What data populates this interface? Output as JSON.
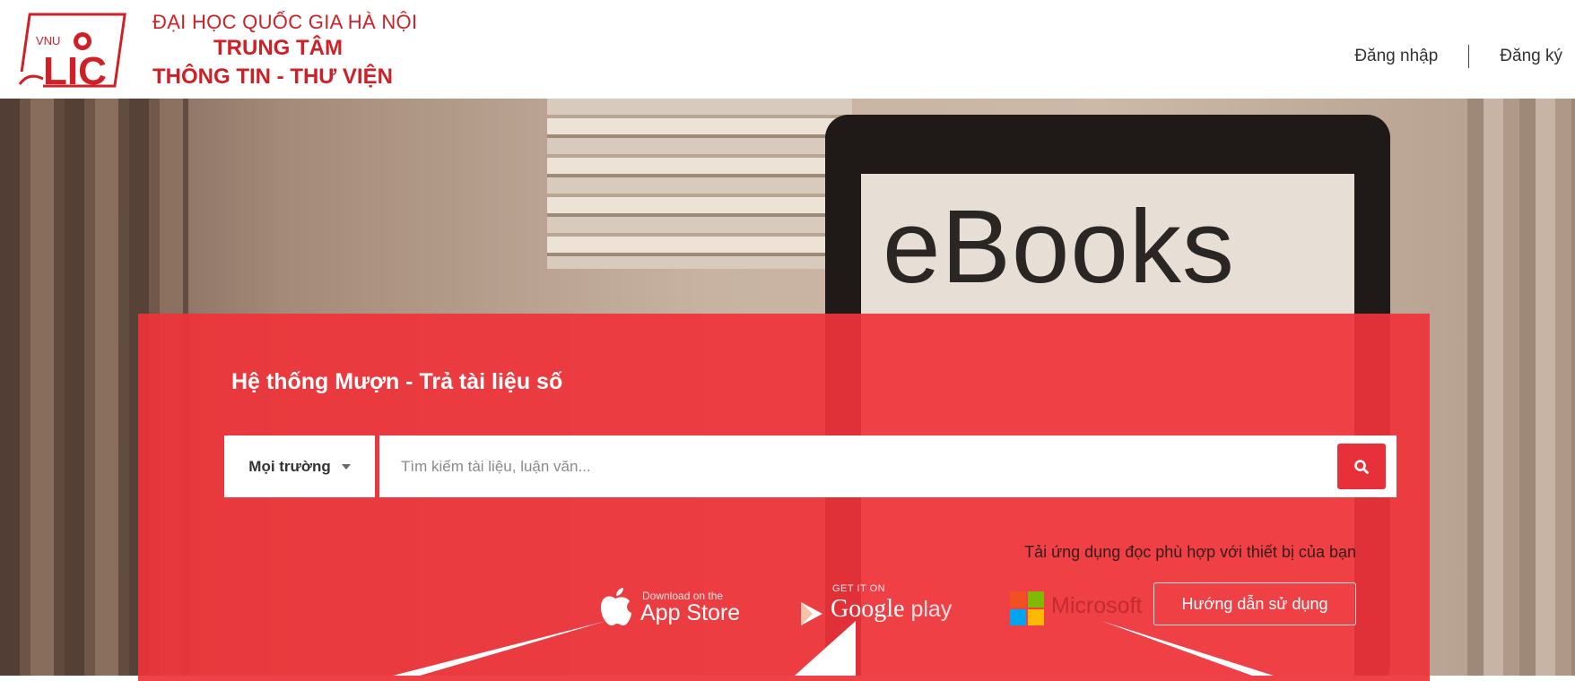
{
  "header": {
    "logo_vnu": "VNU",
    "logo_lic": "LIC",
    "org_line1": "ĐẠI HỌC QUỐC GIA HÀ NỘI",
    "org_line2": "TRUNG TÂM",
    "org_line3": "THÔNG TIN - THƯ VIỆN",
    "login_label": "Đăng nhập",
    "register_label": "Đăng ký"
  },
  "hero": {
    "background_word": "eBooks"
  },
  "panel": {
    "title": "Hệ thống Mượn - Trả tài liệu số",
    "scope_label": "Mọi trường",
    "search_placeholder": "Tìm kiếm tài liệu, luận văn...",
    "search_icon": "search-icon",
    "hint": "Tải ứng dụng đọc phù hợp với thiết bị của bạn",
    "appstore_small": "Download on the",
    "appstore_big": "App Store",
    "gplay_small": "GET IT ON",
    "gplay_big": "Google",
    "gplay_word": "play",
    "microsoft_label": "Microsoft",
    "guide_button": "Hướng dẫn sử dụng"
  },
  "colors": {
    "brand_red": "#cf2027",
    "panel_red": "#ee343a",
    "button_red": "#e8303a",
    "annotation_arrow": "#ffffff"
  }
}
